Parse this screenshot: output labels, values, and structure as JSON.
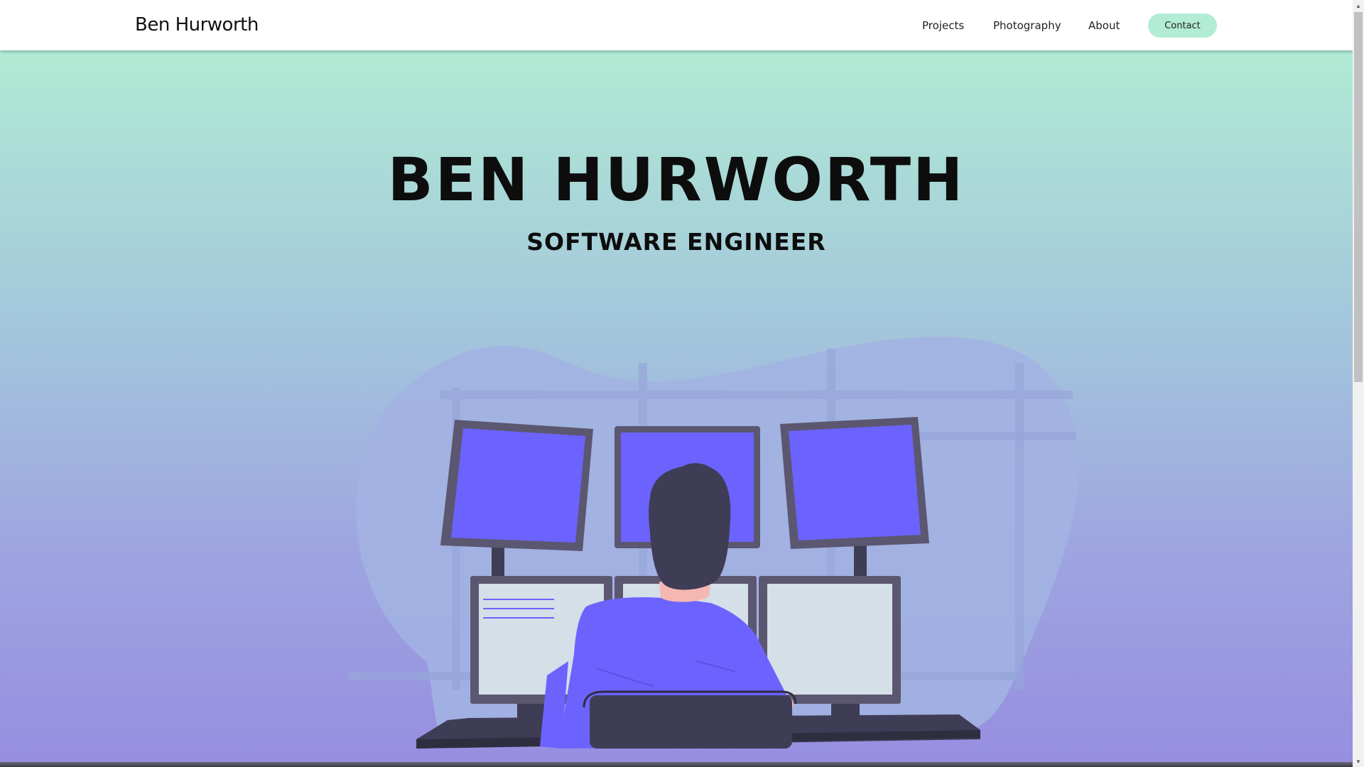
{
  "navbar": {
    "brand": "Ben Hurworth",
    "links": [
      {
        "label": "Projects"
      },
      {
        "label": "Photography"
      },
      {
        "label": "About"
      }
    ],
    "contact_label": "Contact"
  },
  "hero": {
    "title": "BEN HURWORTH",
    "subtitle": "SOFTWARE ENGINEER",
    "illustration_icon": "programmer-at-multiple-monitors-illustration"
  },
  "colors": {
    "gradient_top": "#b0ebd4",
    "gradient_bottom": "#978ee0",
    "accent_purple": "#6c63ff",
    "contact_button": "#b2ecd4",
    "monitor_frame": "#5b5770",
    "dark": "#3f3d56"
  },
  "scrollbar": {
    "position_fraction": 0.0,
    "visible_fraction": 0.48
  }
}
